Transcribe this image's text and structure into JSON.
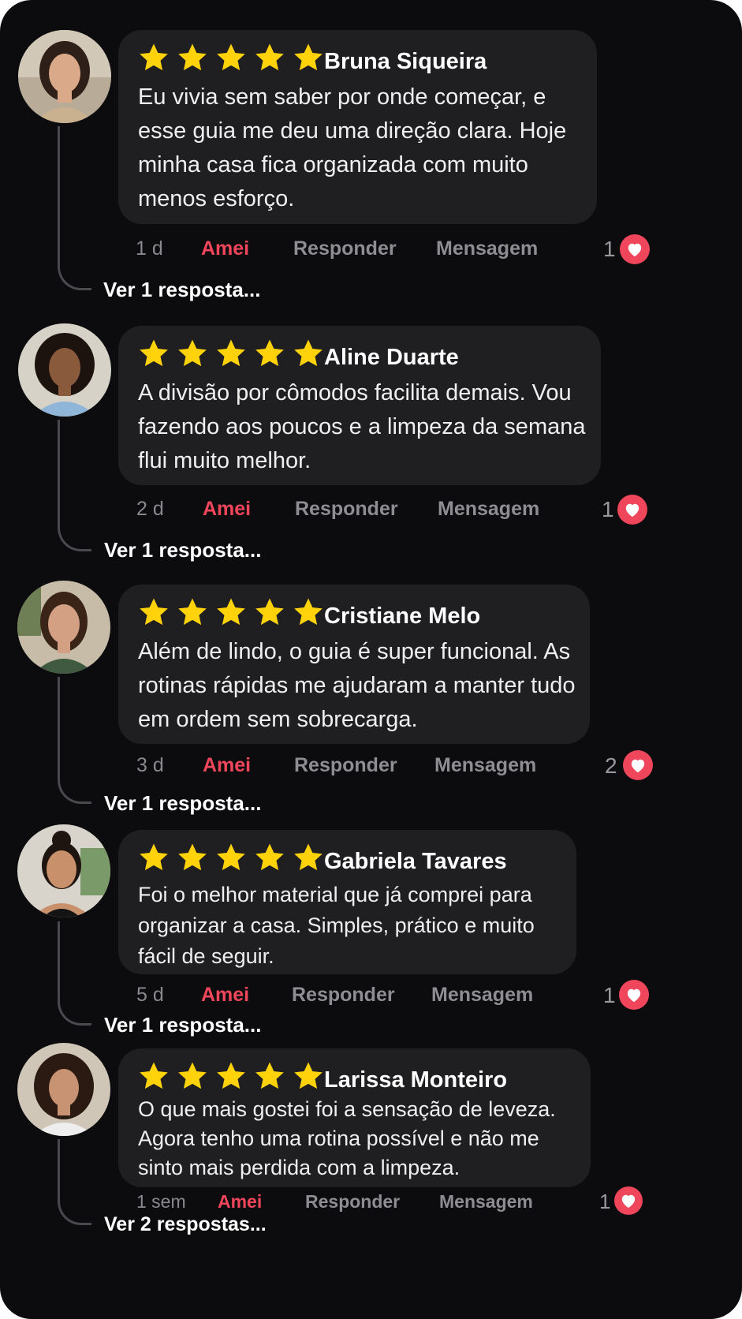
{
  "colors": {
    "background": "#0c0c0e",
    "bubble": "#1f1f22",
    "star": "#ffd20a",
    "amei": "#f0465c",
    "heart": "#f0465c",
    "muted_action": "#8e8e92"
  },
  "icons": {
    "rating": "star-icon",
    "like": "heart-icon"
  },
  "reviews": [
    {
      "name": "Bruna Siqueira",
      "rating": 5,
      "text_lines": [
        "Eu vivia sem saber por onde começar, e",
        "esse guia me deu uma direção clara. Hoje",
        "minha casa fica organizada com muito",
        "menos esforço."
      ],
      "time": "1 d",
      "amei": "Amei",
      "responder": "Responder",
      "mensagem": "Mensagem",
      "likes": "1",
      "replies": "Ver 1 resposta..."
    },
    {
      "name": "Aline Duarte",
      "rating": 5,
      "text_lines": [
        "A divisão por cômodos facilita demais. Vou",
        "fazendo aos poucos e a limpeza da semana",
        "flui muito melhor."
      ],
      "time": "2 d",
      "amei": "Amei",
      "responder": "Responder",
      "mensagem": "Mensagem",
      "likes": "1",
      "replies": "Ver 1 resposta..."
    },
    {
      "name": "Cristiane Melo",
      "rating": 5,
      "text_lines": [
        "Além de lindo, o guia é super funcional. As",
        "rotinas rápidas me ajudaram a manter tudo",
        "em ordem sem sobrecarga."
      ],
      "time": "3 d",
      "amei": "Amei",
      "responder": "Responder",
      "mensagem": "Mensagem",
      "likes": "2",
      "replies": "Ver 1 resposta..."
    },
    {
      "name": "Gabriela Tavares",
      "rating": 5,
      "text_lines": [
        "Foi o melhor material que já comprei para",
        "organizar a casa. Simples, prático e muito",
        "fácil de seguir."
      ],
      "time": "5 d",
      "amei": "Amei",
      "responder": "Responder",
      "mensagem": "Mensagem",
      "likes": "1",
      "replies": "Ver 1 resposta..."
    },
    {
      "name": "Larissa Monteiro",
      "rating": 5,
      "text_lines": [
        "O que mais gostei foi a sensação de leveza.",
        "Agora tenho uma rotina possível e não me",
        "sinto mais perdida com a limpeza."
      ],
      "time": "1 sem",
      "amei": "Amei",
      "responder": "Responder",
      "mensagem": "Mensagem",
      "likes": "1",
      "replies": "Ver 2 respostas..."
    }
  ]
}
